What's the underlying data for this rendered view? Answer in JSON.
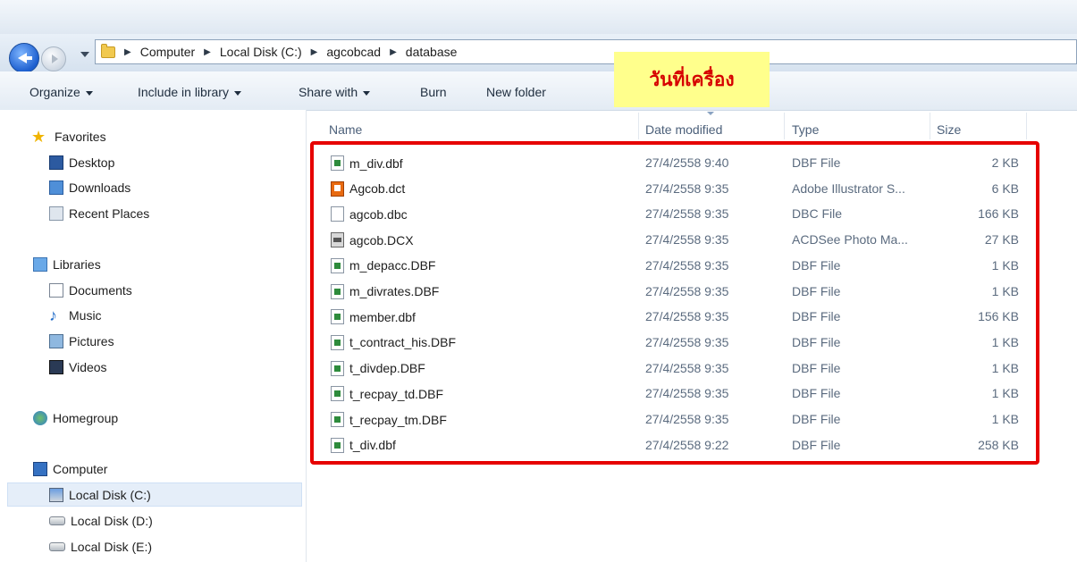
{
  "address": {
    "crumbs": [
      "Computer",
      "Local Disk (C:)",
      "agcobcad",
      "database"
    ]
  },
  "toolbar": {
    "organize": "Organize",
    "include": "Include in library",
    "share": "Share with",
    "burn": "Burn",
    "new_folder": "New folder"
  },
  "callout": "วันที่เครื่อง",
  "sidebar": {
    "favorites": "Favorites",
    "desktop": "Desktop",
    "downloads": "Downloads",
    "recent": "Recent Places",
    "libraries": "Libraries",
    "documents": "Documents",
    "music": "Music",
    "pictures": "Pictures",
    "videos": "Videos",
    "homegroup": "Homegroup",
    "computer": "Computer",
    "disk_c": "Local Disk (C:)",
    "disk_d": "Local Disk (D:)",
    "disk_e": "Local Disk (E:)"
  },
  "columns": {
    "name": "Name",
    "date": "Date modified",
    "type": "Type",
    "size": "Size"
  },
  "files": [
    {
      "name": "m_div.dbf",
      "date": "27/4/2558 9:40",
      "type": "DBF File",
      "size": "2 KB",
      "icon": "dbf-file-icon"
    },
    {
      "name": "Agcob.dct",
      "date": "27/4/2558 9:35",
      "type": "Adobe Illustrator S...",
      "size": "6 KB",
      "icon": "illustrator-file-icon"
    },
    {
      "name": "agcob.dbc",
      "date": "27/4/2558 9:35",
      "type": "DBC File",
      "size": "166 KB",
      "icon": "blank-file-icon"
    },
    {
      "name": "agcob.DCX",
      "date": "27/4/2558 9:35",
      "type": "ACDSee Photo Ma...",
      "size": "27 KB",
      "icon": "acdsee-file-icon"
    },
    {
      "name": "m_depacc.DBF",
      "date": "27/4/2558 9:35",
      "type": "DBF File",
      "size": "1 KB",
      "icon": "dbf-file-icon"
    },
    {
      "name": "m_divrates.DBF",
      "date": "27/4/2558 9:35",
      "type": "DBF File",
      "size": "1 KB",
      "icon": "dbf-file-icon"
    },
    {
      "name": "member.dbf",
      "date": "27/4/2558 9:35",
      "type": "DBF File",
      "size": "156 KB",
      "icon": "dbf-file-icon"
    },
    {
      "name": "t_contract_his.DBF",
      "date": "27/4/2558 9:35",
      "type": "DBF File",
      "size": "1 KB",
      "icon": "dbf-file-icon"
    },
    {
      "name": "t_divdep.DBF",
      "date": "27/4/2558 9:35",
      "type": "DBF File",
      "size": "1 KB",
      "icon": "dbf-file-icon"
    },
    {
      "name": "t_recpay_td.DBF",
      "date": "27/4/2558 9:35",
      "type": "DBF File",
      "size": "1 KB",
      "icon": "dbf-file-icon"
    },
    {
      "name": "t_recpay_tm.DBF",
      "date": "27/4/2558 9:35",
      "type": "DBF File",
      "size": "1 KB",
      "icon": "dbf-file-icon"
    },
    {
      "name": "t_div.dbf",
      "date": "27/4/2558 9:22",
      "type": "DBF File",
      "size": "258 KB",
      "icon": "dbf-file-icon"
    }
  ],
  "colors": {
    "highlight_box": "#e60000",
    "callout_bg": "#ffff8c",
    "callout_text": "#d60000"
  }
}
